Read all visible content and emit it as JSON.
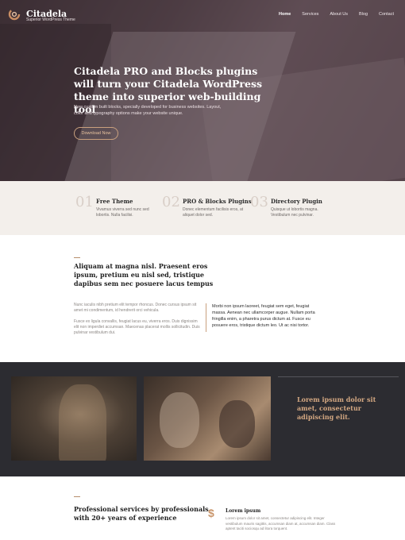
{
  "header": {
    "brand": "Citadela",
    "tagline": "Superior WordPress Theme",
    "nav": [
      "Home",
      "Services",
      "About Us",
      "Blog",
      "Contact"
    ],
    "active_nav": "Home"
  },
  "hero": {
    "title": "Citadela PRO and Blocks plugins will turn your Citadela WordPress theme into superior web-building tool",
    "subtitle": "New custom built blocks, specially developed for business websites. Layout, color and typography options make your website unique.",
    "button_label": "Download Now"
  },
  "features": [
    {
      "num": "01",
      "title": "Free Theme",
      "desc": "Vivamus viverra sed nunc sed lobortis. Nulla facilisi."
    },
    {
      "num": "02",
      "title": "PRO & Blocks Plugins",
      "desc": "Donec elementum facilisis eros, at aliquet dolor sed."
    },
    {
      "num": "03",
      "title": "Directory Plugin",
      "desc": "Quisque ut lobortis magna. Vestibulum nec pulvinar."
    }
  ],
  "about": {
    "title": "Aliquam at magna nisl. Praesent eros ipsum, pretium eu nisl sed, tristique dapibus sem nec posuere lacus tempus",
    "p1": "Nunc iaculis nibh pretium elit tempor rhoncus. Donec cursus ipsum sit amet mi condimentum, id hendrerit orci vehicula.",
    "p2": "Fusce ex ligula convallis, feugiat lacus eu, viverra eros. Duis dignissim elit non imperdiet accumsan. Maecenas placerat mollis sollicitudin. Duis pulvinar vestibulum dui.",
    "quote": "Morbi non ipsum laoreet, feugiat sem eget, feugiat massa. Aenean nec ullamcorper augue. Nullam porta fringilla enim, a pharetra purus dictum at. Fusce eu posuere eros, tristique dictum leo. Ut ac nisi tortor."
  },
  "dark": {
    "title": "Lorem ipsum dolor sit amet, consectetur adipiscing elit."
  },
  "services": {
    "title": "Professional services by professionals with 20+ years of experience",
    "item_title": "Lorem ipsum",
    "item_text": "Lorem ipsum dolor sit amet, consectetur adipiscing elit. Integer vestibulum mauris sagittis, accumsan diam at, accumsan diam. Class aptent taciti sociosqu ad litora torquent."
  },
  "colors": {
    "accent": "#c9a07e",
    "dark_bg": "#2c2c31",
    "features_bg": "#f3efeb"
  }
}
